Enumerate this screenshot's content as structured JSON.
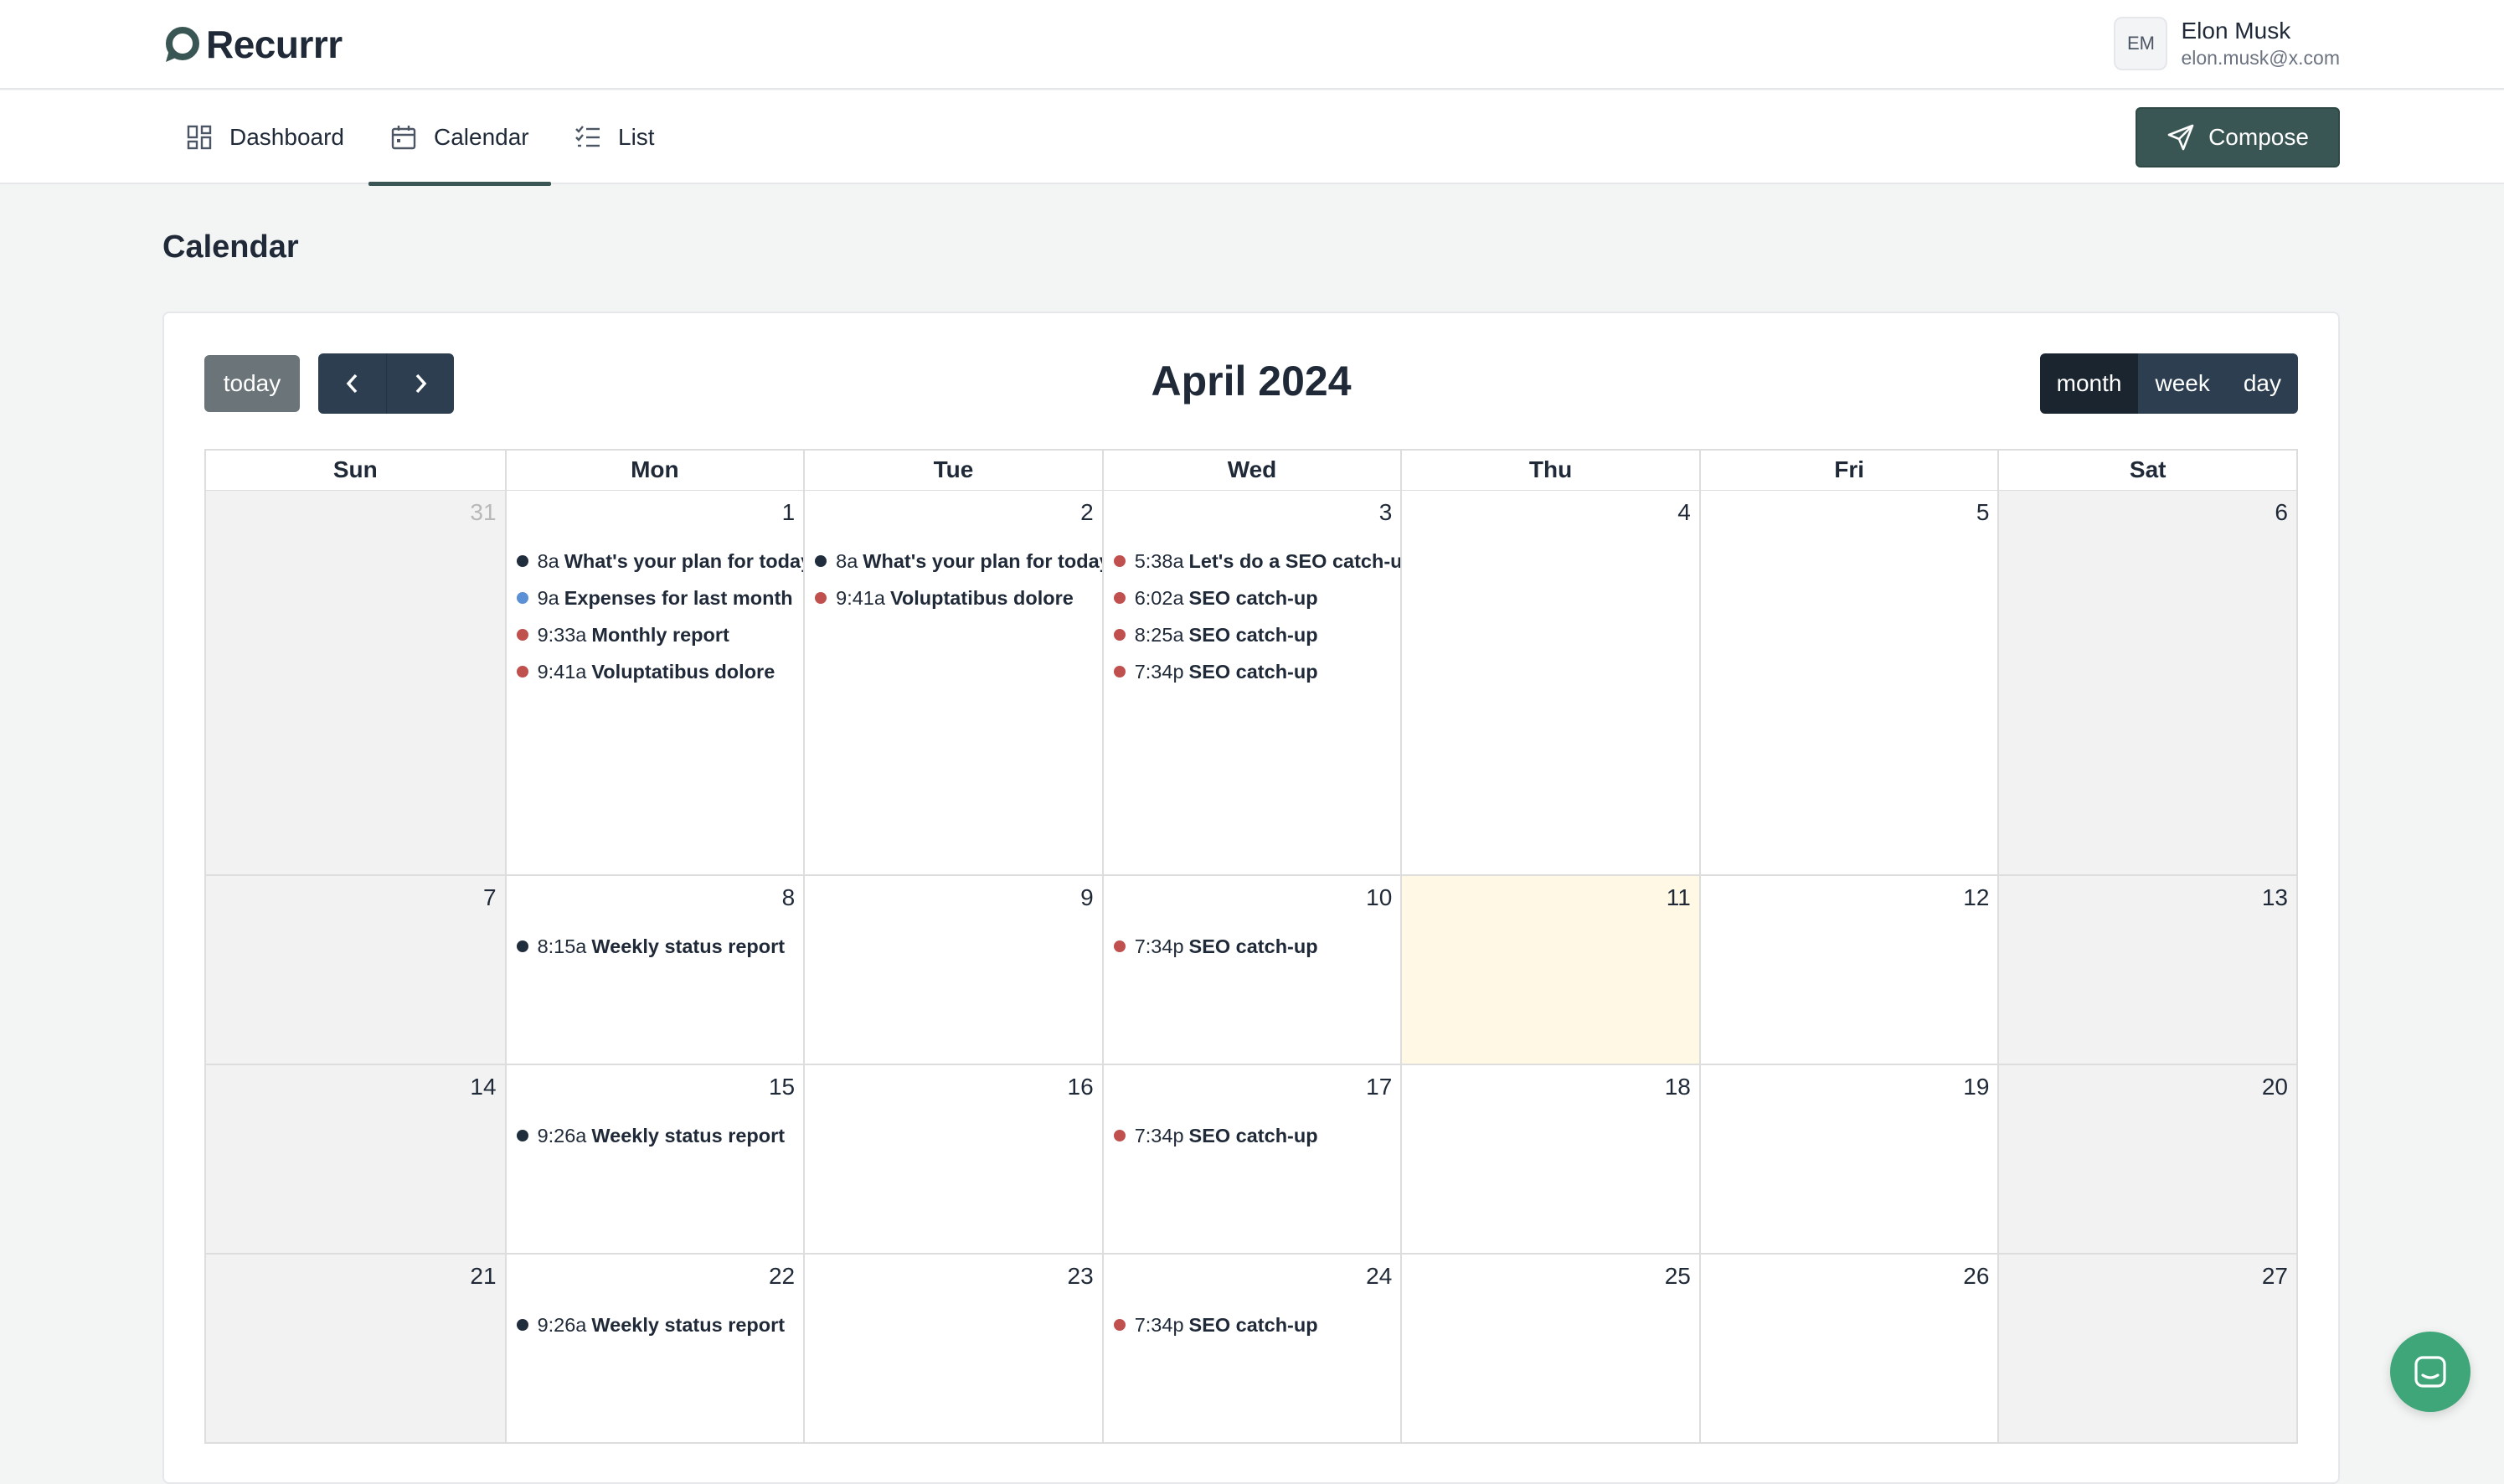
{
  "app": {
    "name": "Recurrr"
  },
  "user": {
    "initials": "EM",
    "name": "Elon Musk",
    "email": "elon.musk@x.com"
  },
  "nav": {
    "tabs": [
      {
        "label": "Dashboard",
        "icon": "dashboard-icon",
        "active": false
      },
      {
        "label": "Calendar",
        "icon": "calendar-icon",
        "active": true
      },
      {
        "label": "List",
        "icon": "list-icon",
        "active": false
      }
    ],
    "compose_label": "Compose"
  },
  "page": {
    "title": "Calendar"
  },
  "calendar": {
    "today_label": "today",
    "title": "April 2024",
    "views": [
      "month",
      "week",
      "day"
    ],
    "active_view": "month",
    "weekdays": [
      "Sun",
      "Mon",
      "Tue",
      "Wed",
      "Thu",
      "Fri",
      "Sat"
    ],
    "event_colors": {
      "dark": "#1f2d3d",
      "red": "#c0504d",
      "blue": "#5b8fd6"
    },
    "weeks": [
      [
        {
          "num": "31",
          "other": true,
          "events": []
        },
        {
          "num": "1",
          "events": [
            {
              "time": "8a",
              "title": "What's your plan for today?",
              "color": "dark"
            },
            {
              "time": "9a",
              "title": "Expenses for last month",
              "color": "blue"
            },
            {
              "time": "9:33a",
              "title": "Monthly report",
              "color": "red"
            },
            {
              "time": "9:41a",
              "title": "Voluptatibus dolore",
              "color": "red"
            }
          ]
        },
        {
          "num": "2",
          "events": [
            {
              "time": "8a",
              "title": "What's your plan for today?",
              "color": "dark"
            },
            {
              "time": "9:41a",
              "title": "Voluptatibus dolore",
              "color": "red"
            }
          ]
        },
        {
          "num": "3",
          "events": [
            {
              "time": "5:38a",
              "title": "Let's do a SEO catch-up",
              "color": "red"
            },
            {
              "time": "6:02a",
              "title": "SEO catch-up",
              "color": "red"
            },
            {
              "time": "8:25a",
              "title": "SEO catch-up",
              "color": "red"
            },
            {
              "time": "7:34p",
              "title": "SEO catch-up",
              "color": "red"
            }
          ]
        },
        {
          "num": "4",
          "events": []
        },
        {
          "num": "5",
          "events": []
        },
        {
          "num": "6",
          "events": []
        }
      ],
      [
        {
          "num": "7",
          "events": []
        },
        {
          "num": "8",
          "events": [
            {
              "time": "8:15a",
              "title": "Weekly status report",
              "color": "dark"
            }
          ]
        },
        {
          "num": "9",
          "events": []
        },
        {
          "num": "10",
          "events": [
            {
              "time": "7:34p",
              "title": "SEO catch-up",
              "color": "red"
            }
          ]
        },
        {
          "num": "11",
          "today": true,
          "events": []
        },
        {
          "num": "12",
          "events": []
        },
        {
          "num": "13",
          "events": []
        }
      ],
      [
        {
          "num": "14",
          "events": []
        },
        {
          "num": "15",
          "events": [
            {
              "time": "9:26a",
              "title": "Weekly status report",
              "color": "dark"
            }
          ]
        },
        {
          "num": "16",
          "events": []
        },
        {
          "num": "17",
          "events": [
            {
              "time": "7:34p",
              "title": "SEO catch-up",
              "color": "red"
            }
          ]
        },
        {
          "num": "18",
          "events": []
        },
        {
          "num": "19",
          "events": []
        },
        {
          "num": "20",
          "events": []
        }
      ],
      [
        {
          "num": "21",
          "events": []
        },
        {
          "num": "22",
          "events": [
            {
              "time": "9:26a",
              "title": "Weekly status report",
              "color": "dark"
            }
          ]
        },
        {
          "num": "23",
          "events": []
        },
        {
          "num": "24",
          "events": [
            {
              "time": "7:34p",
              "title": "SEO catch-up",
              "color": "red"
            }
          ]
        },
        {
          "num": "25",
          "events": []
        },
        {
          "num": "26",
          "events": []
        },
        {
          "num": "27",
          "events": []
        }
      ]
    ]
  }
}
